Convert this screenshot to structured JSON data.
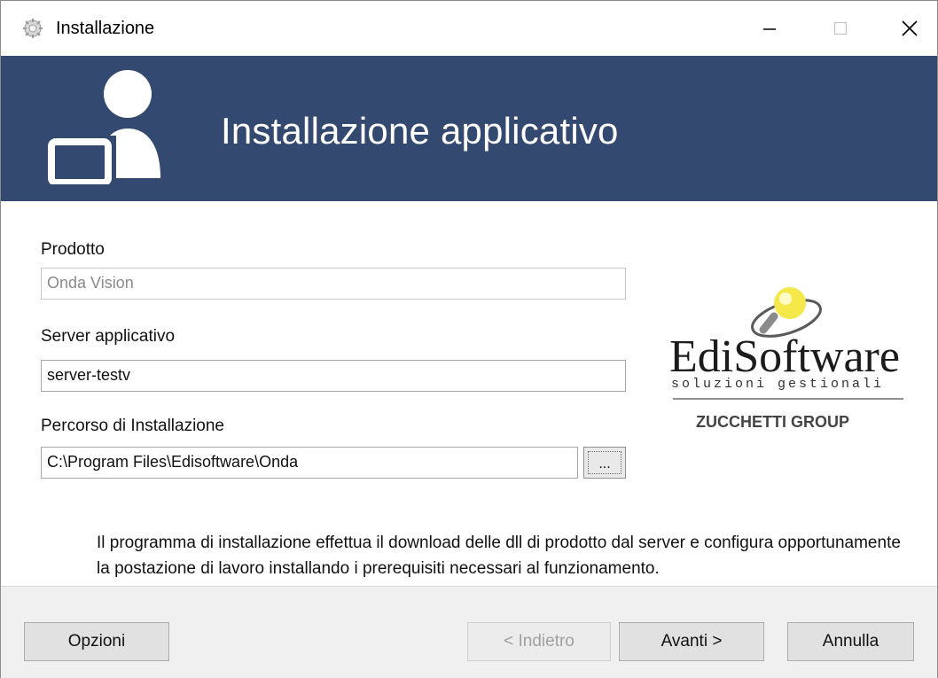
{
  "window": {
    "title": "Installazione",
    "controls": [
      "minimize-icon",
      "maximize-icon",
      "close-icon"
    ]
  },
  "banner": {
    "heading": "Installazione applicativo",
    "icon": "user-computer-icon",
    "background": "#33496f"
  },
  "form": {
    "prodotto": {
      "label": "Prodotto",
      "value": "Onda Vision",
      "disabled": true
    },
    "server": {
      "label": "Server applicativo",
      "value": "server-testv"
    },
    "percorso": {
      "label": "Percorso di Installazione",
      "value": "C:\\Program Files\\Edisoftware\\Onda",
      "browse_label": "..."
    }
  },
  "info": {
    "text": "Il programma di installazione effettua il download delle dll di prodotto dal server e configura opportunamente la postazione di lavoro installando i prerequisiti necessari al funzionamento."
  },
  "brand": {
    "name": "EdiSoftware",
    "tagline": "soluzioni gestionali",
    "group": "ZUCCHETTI GROUP"
  },
  "footer": {
    "options_label": "Opzioni",
    "back_label": "< Indietro",
    "next_label": "Avanti >",
    "cancel_label": "Annulla"
  }
}
